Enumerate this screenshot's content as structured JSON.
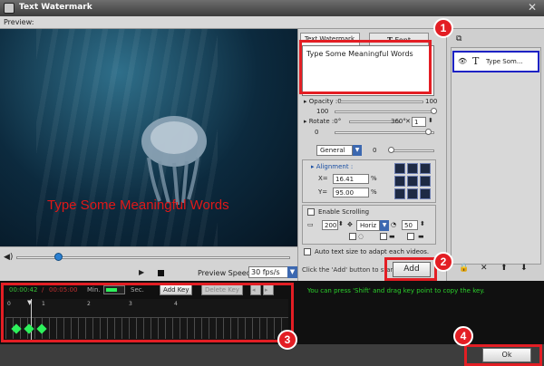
{
  "window": {
    "title": "Text Watermark"
  },
  "preview": {
    "label": "Preview:",
    "watermark_text": "Type Some Meaningful Words",
    "speed_label": "Preview Speed:",
    "speed_value": "30 fps/s",
    "watermark_color": "#e01818"
  },
  "panel": {
    "tabs": [
      "Text Watermark",
      "Font"
    ],
    "text_value": "Type Some Meaningful Words",
    "opacity_label": "Opacity",
    "opacity_min": "0",
    "opacity_max": "100",
    "opacity_value": "100",
    "rotate_label": "Rotate",
    "rotate_min": "0°",
    "rotate_max": "360°",
    "rotate_step": "1",
    "rotate_value": "0",
    "mode": "General",
    "mode_value": "0",
    "alignment_label": "Alignment :",
    "x_label": "X=",
    "x_value": "16.41",
    "y_label": "Y=",
    "y_value": "95.00",
    "percent": "%",
    "scrolling_label": "Enable Scrolling",
    "scroll_speed": "200",
    "scroll_dir": "Horiz",
    "scroll_amount": "50",
    "auto_size_label": "Auto text size to adapt each videos.",
    "hint": "Click the 'Add' button to start.",
    "add_label": "Add"
  },
  "layers": {
    "items": [
      {
        "name": "Type Som..."
      }
    ]
  },
  "timeline": {
    "current": "00:00:42",
    "separator": "/",
    "total": "00:05:00",
    "min_label": "Min.",
    "sec_label": "Sec.",
    "add_key": "Add Key",
    "delete_key": "Delete Key",
    "ticks": [
      "0",
      "1",
      "2",
      "3",
      "4"
    ],
    "copy_hint": "You can press 'Shift' and drag key point to copy the key."
  },
  "footer": {
    "ok_label": "Ok"
  },
  "callouts": [
    "1",
    "2",
    "3",
    "4"
  ],
  "colors": {
    "accent": "#e31e24",
    "selection": "#1d22c4",
    "keyframe": "#2df05b"
  }
}
